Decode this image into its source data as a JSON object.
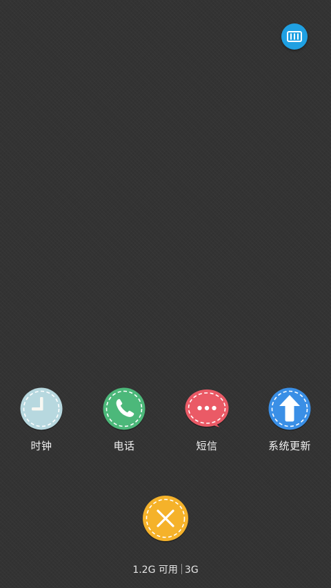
{
  "colors": {
    "background": "#333333",
    "clear_mode_button": "#1fa0e2",
    "clock": "#b7d8df",
    "phone": "#4cb87a",
    "sms": "#ea5a66",
    "system_update": "#3a8fe6",
    "close_all": "#f5b22a"
  },
  "top_right": {
    "icon": "clear-mode-icon"
  },
  "recent_apps": [
    {
      "label": "时钟",
      "icon": "clock-icon"
    },
    {
      "label": "电话",
      "icon": "phone-icon"
    },
    {
      "label": "短信",
      "icon": "sms-icon"
    },
    {
      "label": "系统更新",
      "icon": "up-arrow-icon"
    }
  ],
  "close_all": {
    "icon": "close-icon"
  },
  "memory": {
    "available": "1.2G 可用",
    "total": "3G"
  }
}
